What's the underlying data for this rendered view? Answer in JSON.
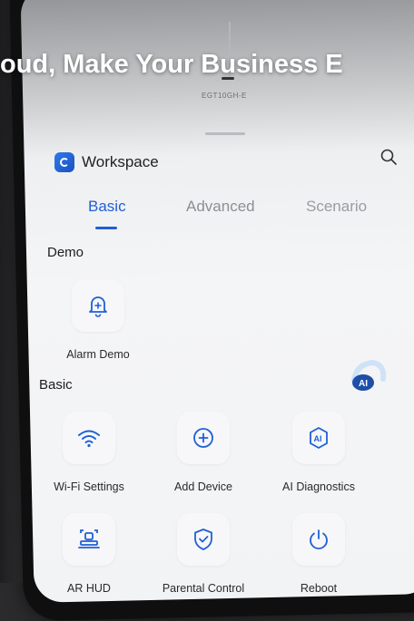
{
  "banner": {
    "text": "oud, Make Your Business E"
  },
  "device": {
    "model": "EGT10GH-E"
  },
  "workspace": {
    "title": "Workspace"
  },
  "tabs": [
    {
      "label": "Basic",
      "active": true
    },
    {
      "label": "Advanced",
      "active": false
    },
    {
      "label": "Scenario",
      "active": false
    }
  ],
  "sections": {
    "demo": {
      "title": "Demo",
      "items": [
        {
          "label": "Alarm Demo",
          "icon": "alarm-bell-icon"
        }
      ]
    },
    "basic": {
      "title": "Basic",
      "items": [
        {
          "label": "Wi-Fi Settings",
          "icon": "wifi-icon"
        },
        {
          "label": "Add Device",
          "icon": "plus-circle-icon"
        },
        {
          "label": "AI Diagnostics",
          "icon": "ai-diagnostics-icon"
        },
        {
          "label": "AR HUD",
          "icon": "ar-scan-icon"
        },
        {
          "label": "Parental Control",
          "icon": "shield-check-icon"
        },
        {
          "label": "Reboot",
          "icon": "power-icon"
        }
      ]
    }
  },
  "colors": {
    "accent": "#1f5fd6",
    "icon_blue": "#1f5fd6",
    "background": "#f3f4f6"
  }
}
